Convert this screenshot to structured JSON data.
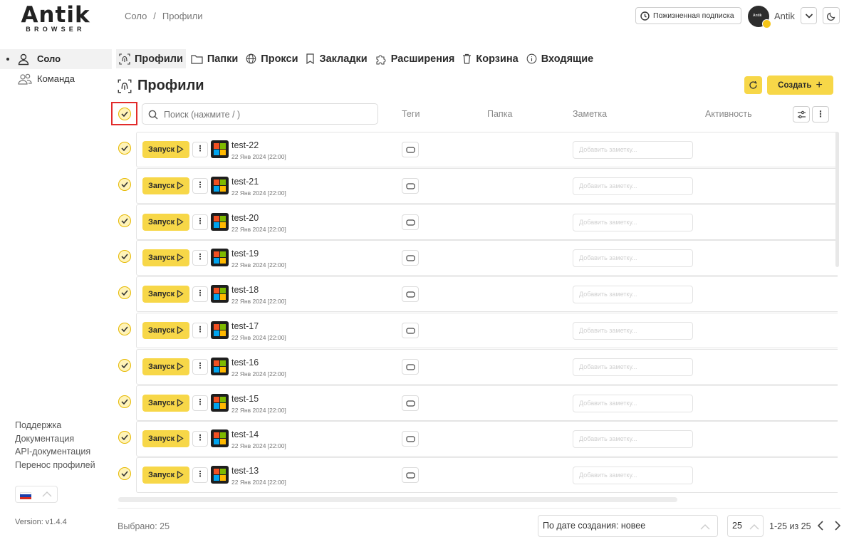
{
  "app": {
    "logo_main": "Antik",
    "logo_sub": "BROWSER",
    "avatar_text": "Antik"
  },
  "sidebar": {
    "items": [
      {
        "label": "Соло",
        "icon": "user-icon",
        "active": true
      },
      {
        "label": "Команда",
        "icon": "team-icon",
        "active": false
      }
    ],
    "links": [
      "Поддержка",
      "Документация",
      "API-документация",
      "Перенос профилей"
    ],
    "language": "ru",
    "version": "Version: v1.4.4"
  },
  "header": {
    "breadcrumb": [
      "Соло",
      "Профили"
    ],
    "subscription": "Пожизненная подписка",
    "user_name": "Antik"
  },
  "tabs": [
    {
      "label": "Профили",
      "icon": "fingerprint-icon",
      "active": true
    },
    {
      "label": "Папки",
      "icon": "folder-icon",
      "active": false
    },
    {
      "label": "Прокси",
      "icon": "globe-icon",
      "active": false
    },
    {
      "label": "Закладки",
      "icon": "bookmark-icon",
      "active": false
    },
    {
      "label": "Расширения",
      "icon": "puzzle-icon",
      "active": false
    },
    {
      "label": "Корзина",
      "icon": "trash-icon",
      "active": false
    },
    {
      "label": "Входящие",
      "icon": "info-icon",
      "active": false
    }
  ],
  "main": {
    "title": "Профили",
    "create_label": "Создать",
    "search_placeholder": "Поиск (нажмите / )",
    "columns": {
      "tags": "Теги",
      "folder": "Папка",
      "note": "Заметка",
      "activity": "Активность"
    },
    "launch_label": "Запуск",
    "note_placeholder": "Добавить заметку...",
    "profiles": [
      {
        "name": "test-22",
        "date": "22 Янв 2024 [22:00]"
      },
      {
        "name": "test-21",
        "date": "22 Янв 2024 [22:00]"
      },
      {
        "name": "test-20",
        "date": "22 Янв 2024 [22:00]"
      },
      {
        "name": "test-19",
        "date": "22 Янв 2024 [22:00]"
      },
      {
        "name": "test-18",
        "date": "22 Янв 2024 [22:00]"
      },
      {
        "name": "test-17",
        "date": "22 Янв 2024 [22:00]"
      },
      {
        "name": "test-16",
        "date": "22 Янв 2024 [22:00]"
      },
      {
        "name": "test-15",
        "date": "22 Янв 2024 [22:00]"
      },
      {
        "name": "test-14",
        "date": "22 Янв 2024 [22:00]"
      },
      {
        "name": "test-13",
        "date": "22 Янв 2024 [22:00]"
      }
    ]
  },
  "footer": {
    "selected": "Выбрано: 25",
    "sort": "По дате создания: новее",
    "per_page": "25",
    "range": "1-25 из 25"
  },
  "colors": {
    "accent": "#f7d748",
    "check_border": "#e6b800",
    "highlight_box": "#e22b2b"
  }
}
